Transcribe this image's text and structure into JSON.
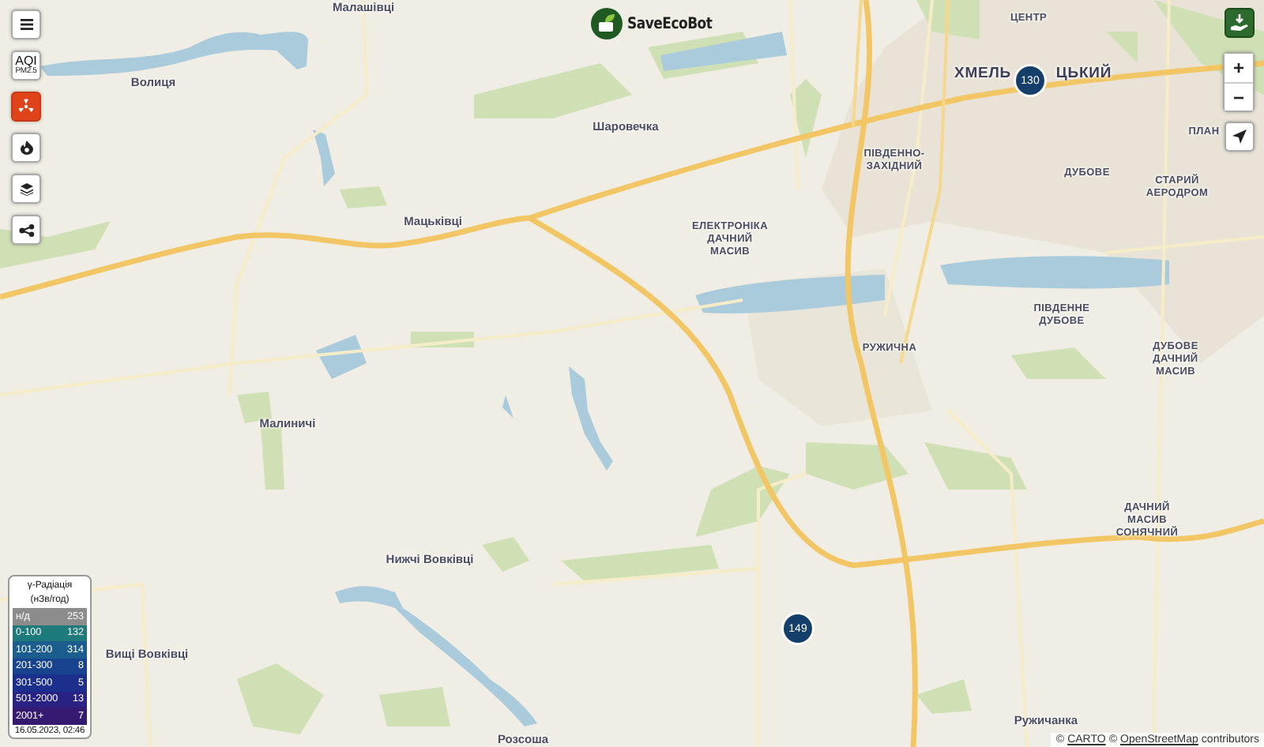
{
  "toolbar": [
    {
      "kind": "menu"
    },
    {
      "kind": "aqi",
      "label": "AQI",
      "sublabel": "PM2.5",
      "selected": false
    },
    {
      "kind": "radiation",
      "selected": true
    },
    {
      "kind": "fire",
      "selected": false
    },
    {
      "kind": "layers"
    },
    {
      "kind": "network"
    }
  ],
  "logo": {
    "text": "SaveEcoBot"
  },
  "controls": {
    "zoom_in": "+",
    "zoom_out": "−"
  },
  "map_labels": [
    {
      "text": "Малашівці",
      "kind": "village"
    },
    {
      "text": "Волиця",
      "kind": "village"
    },
    {
      "text": "Шаровечка",
      "kind": "village"
    },
    {
      "text": "Мацьківці",
      "kind": "village"
    },
    {
      "text": "ЦЕНТР",
      "kind": "district"
    },
    {
      "text": "ХМЕЛЬ",
      "kind": "city"
    },
    {
      "text": "ЦЬКИЙ",
      "kind": "city"
    },
    {
      "text": "ПЛАН",
      "kind": "district"
    },
    {
      "text": "ПІВДЕННО-\nЗАХІДНИЙ",
      "kind": "district"
    },
    {
      "text": "ДУБОВЕ",
      "kind": "district"
    },
    {
      "text": "СТАРИЙ\nАЕРОДРОМ",
      "kind": "district"
    },
    {
      "text": "ЕЛЕКТРОНІКА\nДАЧНИЙ\nМАСИВ",
      "kind": "district"
    },
    {
      "text": "ПІВДЕННЕ\nДУБОВЕ",
      "kind": "district"
    },
    {
      "text": "РУЖИЧНА",
      "kind": "district"
    },
    {
      "text": "ДУБОВЕ\nДАЧНИЙ\nМАСИВ",
      "kind": "district"
    },
    {
      "text": "Малиничі",
      "kind": "village"
    },
    {
      "text": "ДАЧНИЙ\nМАСИВ\nСОНЯЧНИЙ",
      "kind": "district"
    },
    {
      "text": "Нижчі Вовківці",
      "kind": "village"
    },
    {
      "text": "Вищі Вовківці",
      "kind": "village"
    },
    {
      "text": "Розсоша",
      "kind": "village"
    },
    {
      "text": "Ружичанка",
      "kind": "village"
    }
  ],
  "markers": [
    {
      "value": "130"
    },
    {
      "value": "149"
    }
  ],
  "legend": {
    "title": "γ-Радіація",
    "unit": "(нЗв/год)",
    "rows": [
      {
        "label": "н/д",
        "count": "253",
        "color": "#8c8c8c"
      },
      {
        "label": "0-100",
        "count": "132",
        "color": "#1f7b7b"
      },
      {
        "label": "101-200",
        "count": "314",
        "color": "#1b5e8e"
      },
      {
        "label": "201-300",
        "count": "8",
        "color": "#18448f"
      },
      {
        "label": "301-500",
        "count": "5",
        "color": "#1c2f8c"
      },
      {
        "label": "501-2000",
        "count": "13",
        "color": "#282283"
      },
      {
        "label": "2001+",
        "count": "7",
        "color": "#361a72"
      }
    ],
    "timestamp": "16.05.2023, 02:46"
  },
  "attribution": [
    {
      "kind": "text",
      "text": "©"
    },
    {
      "kind": "link",
      "text": "CARTO"
    },
    {
      "kind": "text",
      "text": "©"
    },
    {
      "kind": "link",
      "text": "OpenStreetMap"
    },
    {
      "kind": "text",
      "text": "contributors"
    }
  ]
}
